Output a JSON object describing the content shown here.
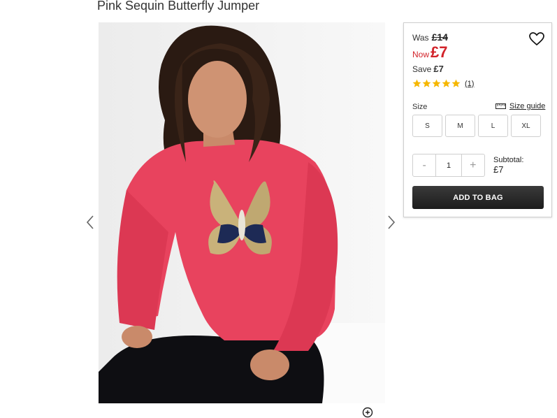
{
  "product": {
    "title": "Pink Sequin Butterfly Jumper",
    "image_alt": "Model wearing pink sequin butterfly jumper"
  },
  "pricing": {
    "was_label": "Was",
    "was_price": "£14",
    "now_label": "Now",
    "now_price": "£7",
    "save_label": "Save",
    "save_amount": "£7"
  },
  "rating": {
    "stars": 5,
    "count_text": "(1)"
  },
  "size": {
    "label": "Size",
    "guide_label": "Size guide",
    "options": [
      "S",
      "M",
      "L",
      "XL"
    ]
  },
  "quantity": {
    "minus": "-",
    "value": "1",
    "plus": "+"
  },
  "subtotal": {
    "label": "Subtotal:",
    "amount": "£7"
  },
  "cta": {
    "add_to_bag": "ADD TO BAG"
  },
  "colors": {
    "accent_red": "#d2232a",
    "star_yellow": "#f6b700",
    "button_dark": "#222222",
    "jumper_pink": "#e8435e"
  },
  "icons": [
    "heart-icon",
    "star-icon",
    "ruler-icon",
    "chevron-left-icon",
    "chevron-right-icon",
    "zoom-icon"
  ]
}
